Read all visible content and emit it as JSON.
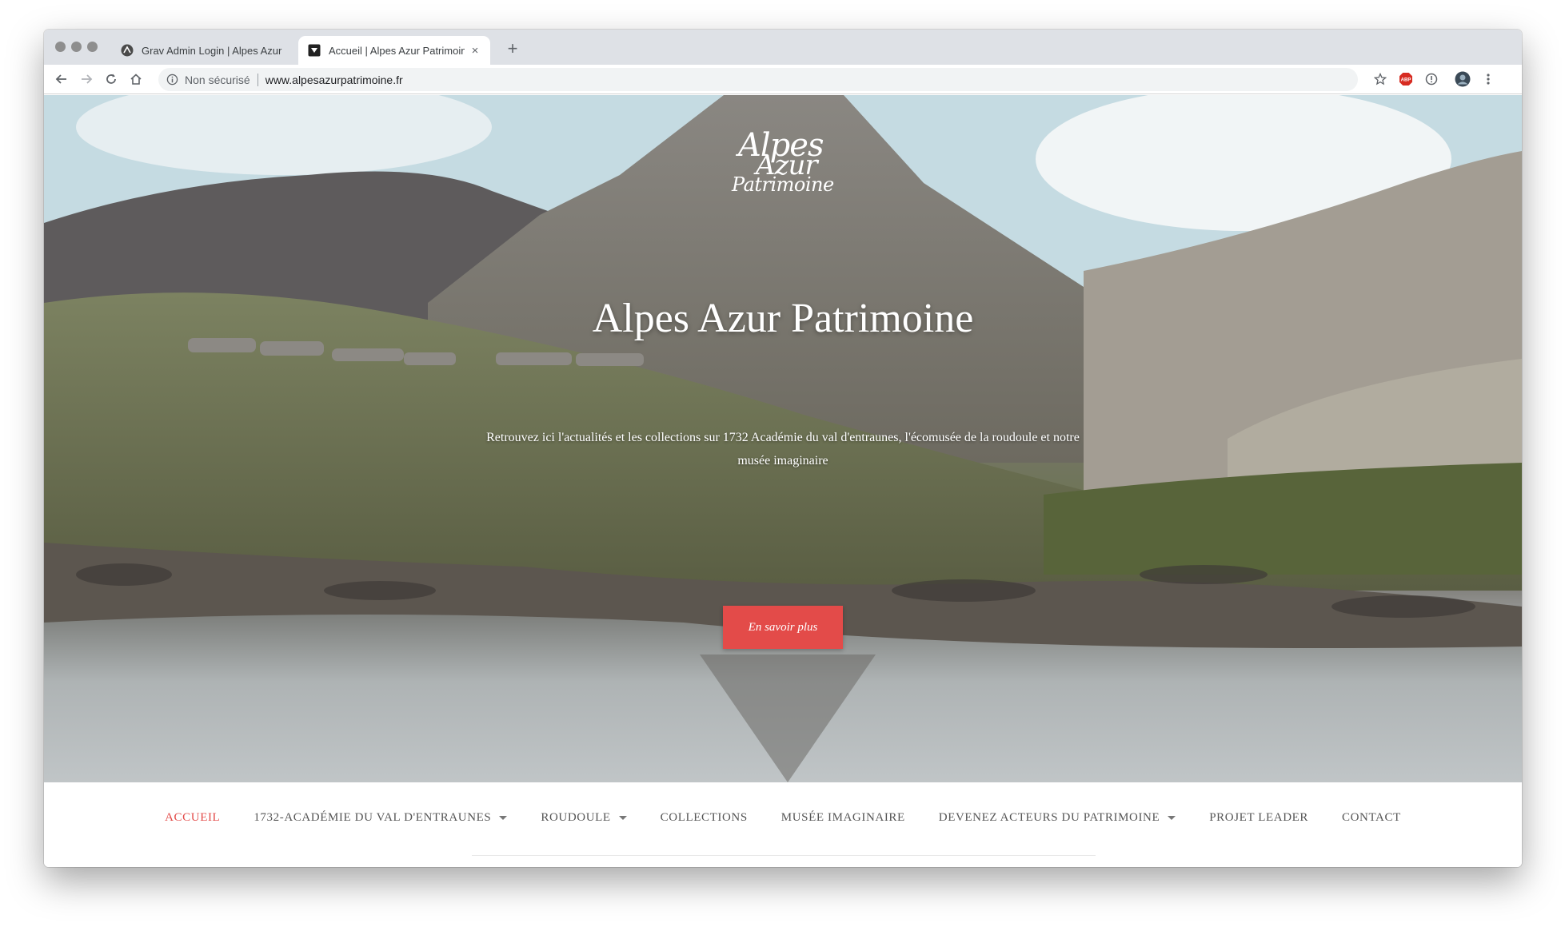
{
  "browser": {
    "tabs": [
      {
        "title": "Grav Admin Login | Alpes Azur",
        "active": false
      },
      {
        "title": "Accueil | Alpes Azur Patrimoine",
        "active": true
      }
    ],
    "new_tab_label": "+",
    "close_label": "×",
    "security_label": "Non sécurisé",
    "url": "www.alpesazurpatrimoine.fr",
    "extensions": [
      "star-icon",
      "adblock-icon",
      "info-icon",
      "profile-avatar",
      "menu-icon"
    ],
    "adblock_label": "ABP"
  },
  "logo": {
    "line1": "Alpes",
    "line2": "Azur",
    "line3": "Patrimoine"
  },
  "hero": {
    "title": "Alpes Azur Patrimoine",
    "text_line1": "Retrouvez ici l'actualités et les collections sur 1732 Académie du val d'entraunes, l'écomusée de la roudoule et notre",
    "text_line2": "musée imaginaire",
    "cta_label": "En savoir plus"
  },
  "nav": {
    "items": [
      {
        "label": "ACCUEIL",
        "active": true,
        "dropdown": false
      },
      {
        "label": "1732-ACADÉMIE DU VAL D'ENTRAUNES",
        "active": false,
        "dropdown": true
      },
      {
        "label": "ROUDOULE",
        "active": false,
        "dropdown": true
      },
      {
        "label": "COLLECTIONS",
        "active": false,
        "dropdown": false
      },
      {
        "label": "MUSÉE IMAGINAIRE",
        "active": false,
        "dropdown": false
      },
      {
        "label": "DEVENEZ ACTEURS DU PATRIMOINE",
        "active": false,
        "dropdown": true
      },
      {
        "label": "PROJET LEADER",
        "active": false,
        "dropdown": false
      },
      {
        "label": "CONTACT",
        "active": false,
        "dropdown": false
      }
    ]
  },
  "colors": {
    "accent": "#e34b49",
    "nav_text": "#555555",
    "tab_bar": "#dee1e6"
  }
}
